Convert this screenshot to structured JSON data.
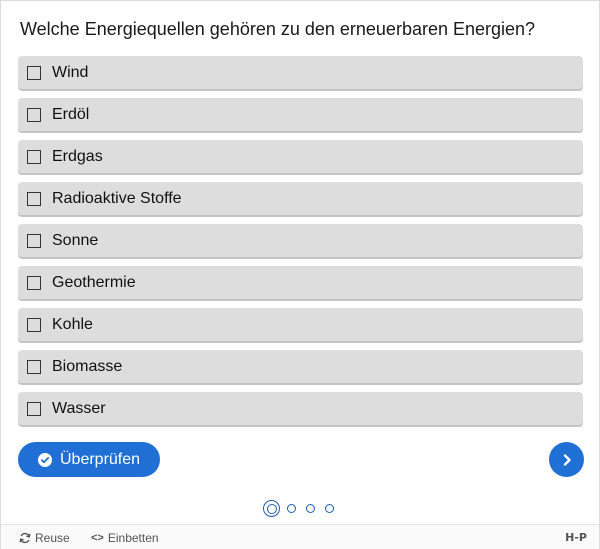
{
  "question": "Welche Energiequellen gehören zu den erneuerbaren Energien?",
  "answers": [
    {
      "label": "Wind",
      "checked": false
    },
    {
      "label": "Erdöl",
      "checked": false
    },
    {
      "label": "Erdgas",
      "checked": false
    },
    {
      "label": "Radioaktive Stoffe",
      "checked": false
    },
    {
      "label": "Sonne",
      "checked": false
    },
    {
      "label": "Geothermie",
      "checked": false
    },
    {
      "label": "Kohle",
      "checked": false
    },
    {
      "label": "Biomasse",
      "checked": false
    },
    {
      "label": "Wasser",
      "checked": false
    }
  ],
  "check_button": {
    "label": "Überprüfen",
    "icon": "check-circle-icon"
  },
  "next_button": {
    "icon": "chevron-right-icon"
  },
  "pagination": {
    "total": 4,
    "current": 1
  },
  "footer": {
    "reuse_label": "Reuse",
    "embed_label": "Einbetten",
    "logo": "H-P"
  },
  "colors": {
    "accent": "#1f6fd4",
    "answer_bg": "#dddddd"
  }
}
